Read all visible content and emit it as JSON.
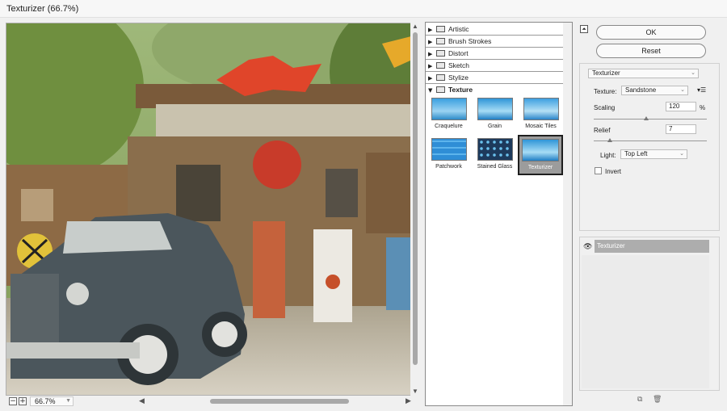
{
  "window": {
    "title": "Texturizer (66.7%)"
  },
  "preview": {
    "zoom": "66.7%"
  },
  "gallery": {
    "categories": [
      {
        "label": "Artistic",
        "expanded": false
      },
      {
        "label": "Brush Strokes",
        "expanded": false
      },
      {
        "label": "Distort",
        "expanded": false
      },
      {
        "label": "Sketch",
        "expanded": false
      },
      {
        "label": "Stylize",
        "expanded": false
      },
      {
        "label": "Texture",
        "expanded": true
      }
    ],
    "filters": [
      {
        "label": "Craquelure"
      },
      {
        "label": "Grain"
      },
      {
        "label": "Mosaic Tiles"
      },
      {
        "label": "Patchwork"
      },
      {
        "label": "Stained Glass"
      },
      {
        "label": "Texturizer",
        "selected": true
      }
    ]
  },
  "buttons": {
    "ok": "OK",
    "reset": "Reset"
  },
  "settings": {
    "filter": "Texturizer",
    "texture_label": "Texture:",
    "texture_value": "Sandstone",
    "scaling_label": "Scaling",
    "scaling_value": "120",
    "scaling_unit": "%",
    "relief_label": "Relief",
    "relief_value": "7",
    "light_label": "Light:",
    "light_value": "Top Left",
    "invert_label": "Invert",
    "invert_checked": false
  },
  "layers": {
    "items": [
      {
        "label": "Texturizer",
        "visible": true
      }
    ]
  },
  "colors": {
    "accent": "#1e1e1e",
    "selected_thumb_bg": "#9c9c9c"
  }
}
